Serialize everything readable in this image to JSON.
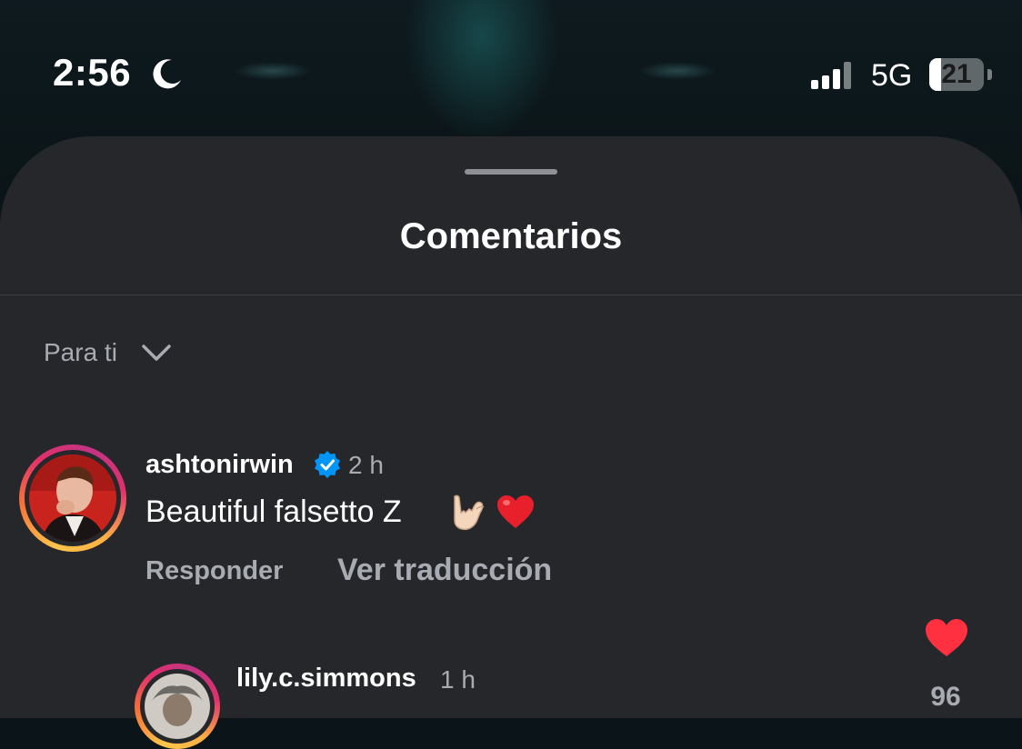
{
  "status_bar": {
    "time": "2:56",
    "focus_icon": "moon-icon",
    "network": "5G",
    "battery_level": "21",
    "battery_fraction": 0.21
  },
  "sheet": {
    "title": "Comentarios",
    "sort_label": "Para ti"
  },
  "comments": [
    {
      "username": "ashtonirwin",
      "verified": true,
      "time": "2 h",
      "text": "Beautiful falsetto Z",
      "reply_label": "Responder",
      "translate_label": "Ver traducción",
      "liked": true,
      "like_count": "96"
    },
    {
      "username": "lily.c.simmons",
      "time": "1 h"
    }
  ],
  "colors": {
    "sheet_bg": "#25272b",
    "secondary_text": "#a8abb1",
    "like_red": "#ff3040",
    "verified_blue": "#0095f6"
  }
}
